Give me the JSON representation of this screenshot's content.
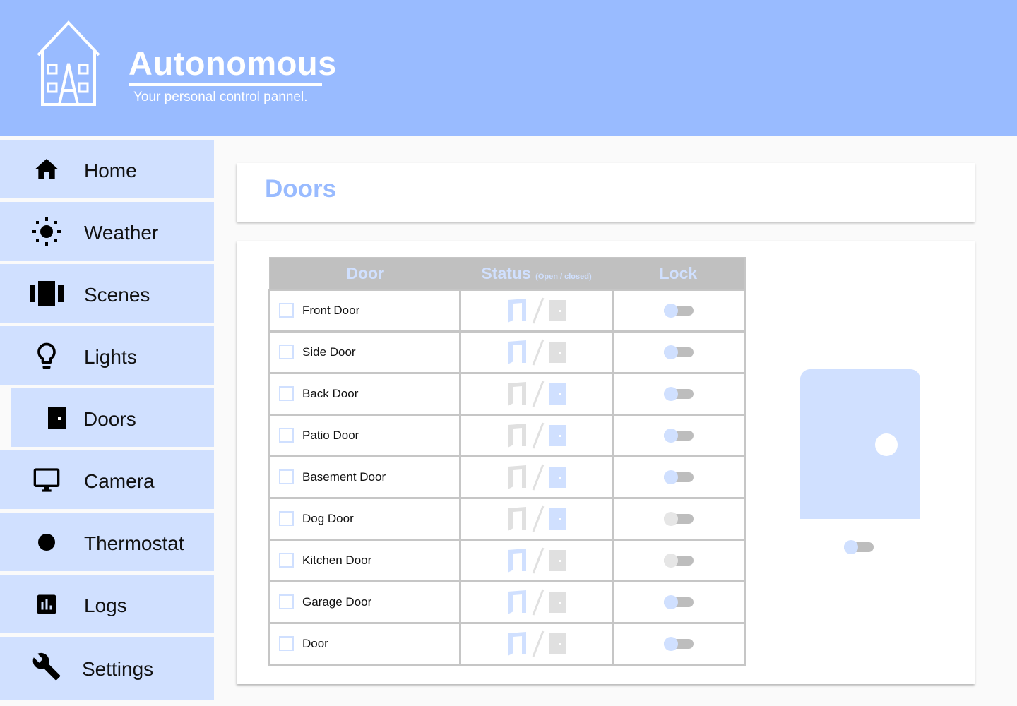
{
  "brand": {
    "title": "Autonomous",
    "subtitle": "Your personal control pannel."
  },
  "sidebar": {
    "items": [
      {
        "label": "Home",
        "icon": "home-icon"
      },
      {
        "label": "Weather",
        "icon": "sun-icon"
      },
      {
        "label": "Scenes",
        "icon": "scenes-icon"
      },
      {
        "label": "Lights",
        "icon": "lightbulb-icon"
      },
      {
        "label": "Doors",
        "icon": "door-icon",
        "active": true
      },
      {
        "label": "Camera",
        "icon": "monitor-icon"
      },
      {
        "label": "Thermostat",
        "icon": "dot-icon"
      },
      {
        "label": "Logs",
        "icon": "bar-chart-icon"
      },
      {
        "label": "Settings",
        "icon": "wrench-icon"
      }
    ]
  },
  "page": {
    "title": "Doors"
  },
  "table": {
    "headers": {
      "door": "Door",
      "status": "Status",
      "status_hint": "(Open / closed)",
      "lock": "Lock"
    },
    "rows": [
      {
        "name": "Front Door",
        "status": "open",
        "locked": false
      },
      {
        "name": "Side Door",
        "status": "open",
        "locked": false
      },
      {
        "name": "Back Door",
        "status": "closed",
        "locked": false
      },
      {
        "name": "Patio Door",
        "status": "closed",
        "locked": false
      },
      {
        "name": "Basement Door",
        "status": "closed",
        "locked": false
      },
      {
        "name": "Dog Door",
        "status": "closed",
        "locked": false
      },
      {
        "name": "Kitchen Door",
        "status": "open",
        "locked": false
      },
      {
        "name": "Garage Door",
        "status": "open",
        "locked": false
      },
      {
        "name": "Door",
        "status": "open",
        "locked": false
      }
    ]
  },
  "preview": {
    "locked": false
  },
  "colors": {
    "header_bg": "#99bbff",
    "accent": "#99bbff",
    "nav_bg": "#d0e0ff",
    "inactive": "#e0e0e0",
    "toggle_track": "#bdbdbd",
    "toggle_knob_on": "#d0e0ff",
    "toggle_knob_off": "#e6e6e6"
  }
}
